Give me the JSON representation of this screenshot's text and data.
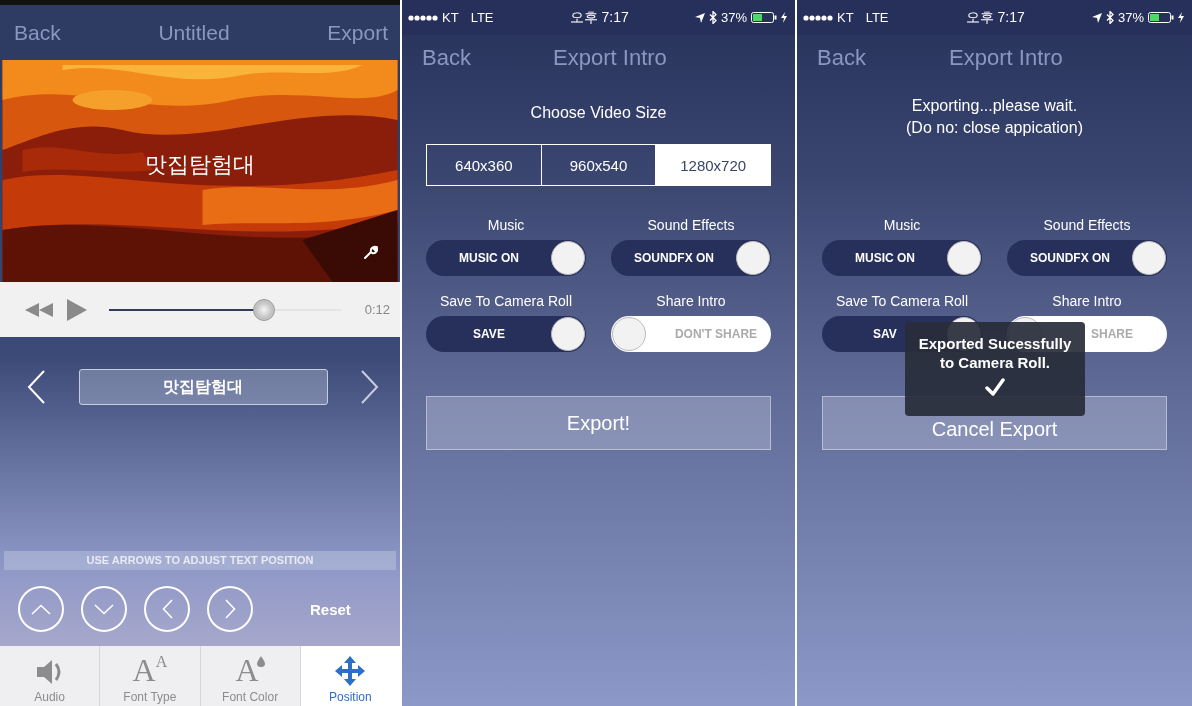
{
  "editor": {
    "nav": {
      "back": "Back",
      "title": "Untitled",
      "action": "Export"
    },
    "preview": {
      "kind": "picture",
      "caption": "맛집탐험대"
    },
    "player": {
      "level": 0.67,
      "time": "0:12"
    },
    "title_field": {
      "value": "맛집탐험대"
    },
    "hint": "USE ARROWS TO ADJUST TEXT POSITION",
    "reset": "Reset",
    "tabs": [
      {
        "kind": "audio",
        "label": "Audio",
        "selected": false
      },
      {
        "kind": "font-type",
        "glyph": "A$^{A}$",
        "label": "Font Type",
        "selected": false
      },
      {
        "kind": "font-color",
        "glyph": "A",
        "label": "Font Color",
        "selected": false
      },
      {
        "kind": "position",
        "label": "Position",
        "selected": true
      }
    ]
  },
  "export_screens": [
    {
      "status_bar": {
        "carrier": "KT",
        "network": "LTE",
        "time": "오후 7:17",
        "battery": "37%"
      },
      "nav": {
        "back": "Back",
        "title": "Export Intro"
      },
      "heading": [
        "Choose Video Size"
      ],
      "size_options": [
        {
          "label": "640x360",
          "selected": false
        },
        {
          "label": "960x540",
          "selected": false
        },
        {
          "label": "1280x720",
          "selected": true
        }
      ],
      "toggles": [
        {
          "label": "Music",
          "text": "MUSIC ON",
          "on": true
        },
        {
          "label": "Sound Effects",
          "text": "SOUNDFX ON",
          "on": true
        },
        {
          "label": "Save To Camera Roll",
          "text": "SAVE",
          "on": true
        },
        {
          "label": "Share Intro",
          "text": "DON'T SHARE",
          "on": false
        }
      ],
      "button": "Export!"
    },
    {
      "status_bar": {
        "carrier": "KT",
        "network": "LTE",
        "time": "오후 7:17",
        "battery": "37%"
      },
      "nav": {
        "back": "Back",
        "title": "Export Intro"
      },
      "heading": [
        "Exporting...please wait.",
        "(Do no: close appication)"
      ],
      "toggles": [
        {
          "label": "Music",
          "text": "MUSIC ON",
          "on": true
        },
        {
          "label": "Sound Effects",
          "text": "SOUNDFX ON",
          "on": true
        },
        {
          "label": "Save To Camera Roll",
          "text": "SAV",
          "on": true
        },
        {
          "label": "Share Intro",
          "text": "SHARE",
          "on": false
        }
      ],
      "button": "Cancel Export",
      "toast": {
        "message": "Exported Sucessfully to Camera Roll."
      }
    }
  ]
}
